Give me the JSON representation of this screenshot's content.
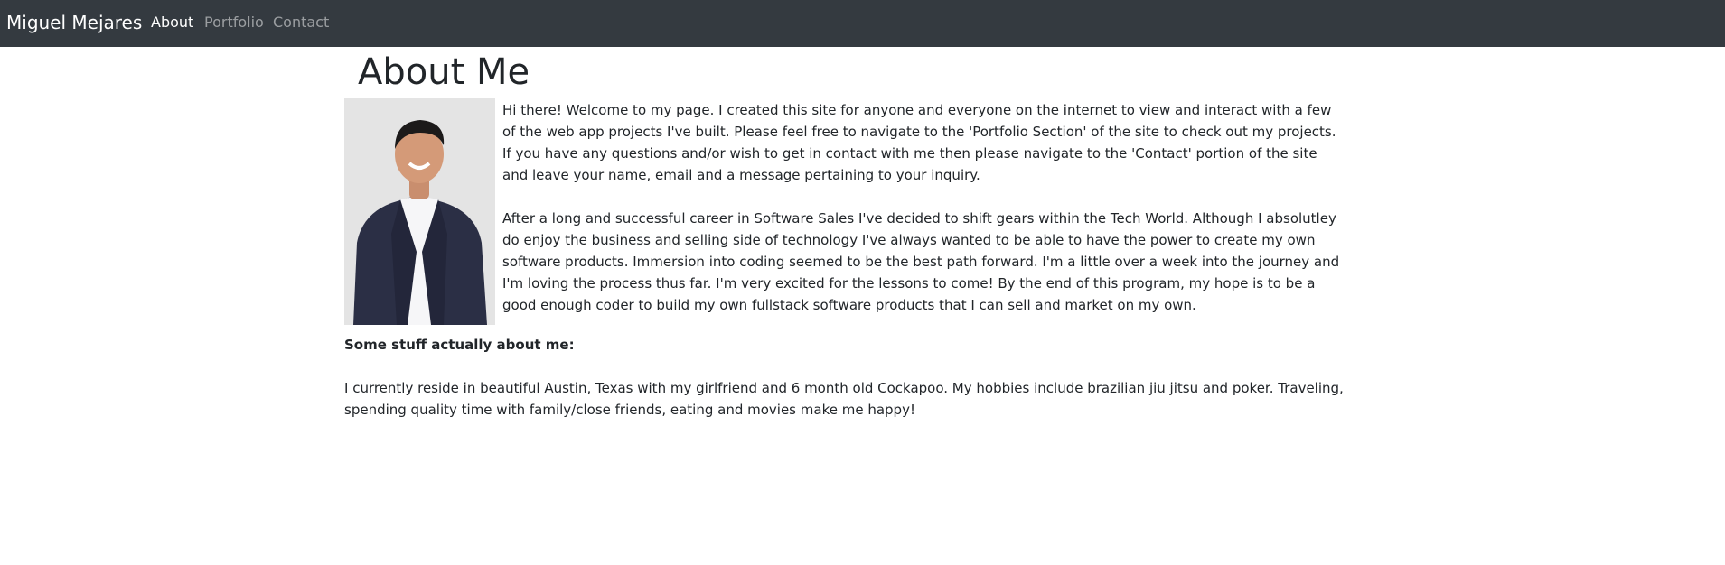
{
  "navbar": {
    "brand": "Miguel Mejares",
    "links": [
      {
        "label": "About",
        "active": true
      },
      {
        "label": "Portfolio",
        "active": false
      },
      {
        "label": "Contact",
        "active": false
      }
    ]
  },
  "main": {
    "title": "About Me",
    "intro_paragraphs": [
      "Hi there! Welcome to my page. I created this site for anyone and everyone on the internet to view and interact with a few of the web app projects I've built. Please feel free to navigate to the 'Portfolio Section' of the site to check out my projects. If you have any questions and/or wish to get in contact with me then please navigate to the 'Contact' portion of the site and leave your name, email and a message pertaining to your inquiry.",
      "After a long and successful career in Software Sales I've decided to shift gears within the Tech World. Although I absolutley do enjoy the business and selling side of technology I've always wanted to be able to have the power to create my own software products. Immersion into coding seemed to be the best path forward. I'm a little over a week into the journey and I'm loving the process thus far. I'm very excited for the lessons to come! By the end of this program, my hope is to be a good enough coder to build my own fullstack software products that I can sell and market on my own."
    ],
    "about_heading": "Some stuff actually about me:",
    "about_text": "I currently reside in beautiful Austin, Texas with my girlfriend and 6 month old Cockapoo. My hobbies include brazilian jiu jitsu and poker. Traveling, spending quality time with family/close friends, eating and movies make me happy!"
  },
  "colors": {
    "navbar_bg": "#343a40",
    "nav_active": "#ffffff",
    "nav_inactive": "rgba(255,255,255,0.5)",
    "text": "#212529"
  },
  "icons": {
    "profile_photo": "person-portrait"
  }
}
